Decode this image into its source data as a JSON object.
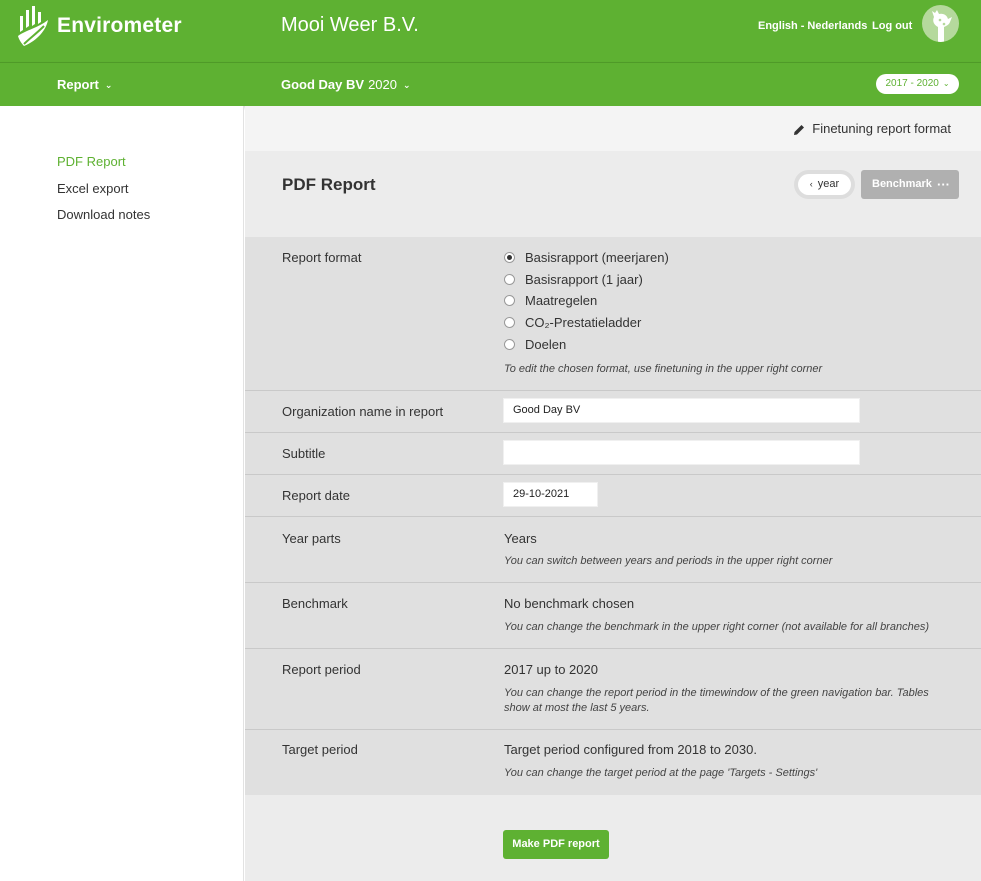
{
  "header": {
    "brand": "Envirometer",
    "company": "Mooi Weer B.V.",
    "lang_english": "English",
    "lang_sep": "-",
    "lang_dutch": "Nederlands",
    "logout": "Log out"
  },
  "subnav": {
    "report_menu": "Report",
    "org_name": "Good Day BV",
    "org_year": "2020",
    "period": "2017 - 2020"
  },
  "sidebar": {
    "items": [
      {
        "label": "PDF Report",
        "active": true
      },
      {
        "label": "Excel export",
        "active": false
      },
      {
        "label": "Download notes",
        "active": false
      }
    ]
  },
  "main": {
    "finetune": "Finetuning report format",
    "title": "PDF Report",
    "year_toggle": "year",
    "benchmark_btn": "Benchmark",
    "benchmark_dots": "···",
    "report_format": {
      "label": "Report format",
      "options": [
        {
          "text": "Basisrapport (meerjaren)",
          "selected": true
        },
        {
          "text": "Basisrapport (1 jaar)",
          "selected": false
        },
        {
          "text": "Maatregelen",
          "selected": false
        },
        {
          "text": "CO₂-Prestatieladder",
          "selected": false
        },
        {
          "text": "Doelen",
          "selected": false
        }
      ],
      "hint": "To edit the chosen format, use finetuning in the upper right corner"
    },
    "org_name": {
      "label": "Organization name in report",
      "value": "Good Day BV"
    },
    "subtitle": {
      "label": "Subtitle",
      "value": ""
    },
    "report_date": {
      "label": "Report date",
      "value": "29-10-2021"
    },
    "year_parts": {
      "label": "Year parts",
      "value": "Years",
      "hint": "You can switch between years and periods in the upper right corner"
    },
    "benchmark": {
      "label": "Benchmark",
      "value": "No benchmark chosen",
      "hint": "You can change the benchmark in the upper right corner (not available for all branches)"
    },
    "report_period": {
      "label": "Report period",
      "value": "2017 up to 2020",
      "hint": "You can change the report period in the timewindow of the green navigation bar. Tables show at most the last 5 years."
    },
    "target_period": {
      "label": "Target period",
      "value": "Target period configured from 2018 to 2030.",
      "hint": "You can change the target period at the page 'Targets - Settings'"
    },
    "submit": "Make PDF report"
  },
  "colors": {
    "brand_green": "#5eb132",
    "panel_grey": "#e0e0e0",
    "button_grey": "#b0b0b0"
  },
  "icons": [
    "envirometer-logo-icon",
    "giraffe-avatar-icon",
    "chevron-down-icon",
    "chevron-left-icon",
    "pencil-icon",
    "more-dots-icon"
  ]
}
